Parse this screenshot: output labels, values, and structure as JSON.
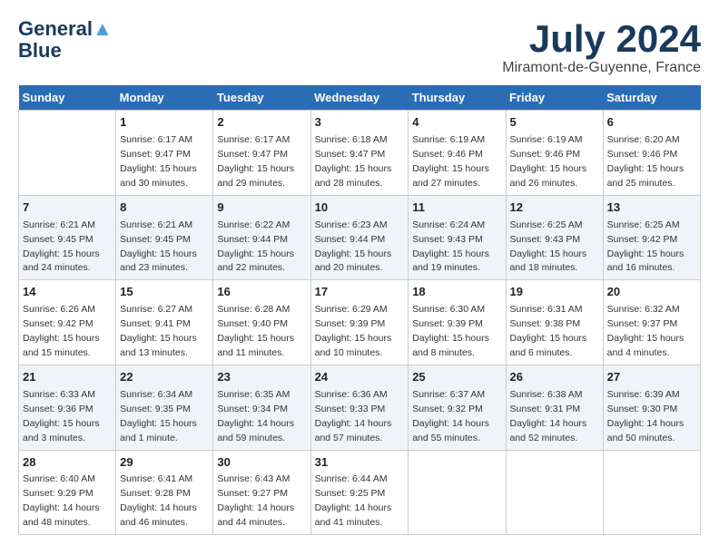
{
  "header": {
    "logo_line1": "General",
    "logo_line2": "Blue",
    "month_title": "July 2024",
    "location": "Miramont-de-Guyenne, France"
  },
  "days_of_week": [
    "Sunday",
    "Monday",
    "Tuesday",
    "Wednesday",
    "Thursday",
    "Friday",
    "Saturday"
  ],
  "weeks": [
    [
      {
        "day": "",
        "sunrise": "",
        "sunset": "",
        "daylight": ""
      },
      {
        "day": "1",
        "sunrise": "Sunrise: 6:17 AM",
        "sunset": "Sunset: 9:47 PM",
        "daylight": "Daylight: 15 hours and 30 minutes."
      },
      {
        "day": "2",
        "sunrise": "Sunrise: 6:17 AM",
        "sunset": "Sunset: 9:47 PM",
        "daylight": "Daylight: 15 hours and 29 minutes."
      },
      {
        "day": "3",
        "sunrise": "Sunrise: 6:18 AM",
        "sunset": "Sunset: 9:47 PM",
        "daylight": "Daylight: 15 hours and 28 minutes."
      },
      {
        "day": "4",
        "sunrise": "Sunrise: 6:19 AM",
        "sunset": "Sunset: 9:46 PM",
        "daylight": "Daylight: 15 hours and 27 minutes."
      },
      {
        "day": "5",
        "sunrise": "Sunrise: 6:19 AM",
        "sunset": "Sunset: 9:46 PM",
        "daylight": "Daylight: 15 hours and 26 minutes."
      },
      {
        "day": "6",
        "sunrise": "Sunrise: 6:20 AM",
        "sunset": "Sunset: 9:46 PM",
        "daylight": "Daylight: 15 hours and 25 minutes."
      }
    ],
    [
      {
        "day": "7",
        "sunrise": "Sunrise: 6:21 AM",
        "sunset": "Sunset: 9:45 PM",
        "daylight": "Daylight: 15 hours and 24 minutes."
      },
      {
        "day": "8",
        "sunrise": "Sunrise: 6:21 AM",
        "sunset": "Sunset: 9:45 PM",
        "daylight": "Daylight: 15 hours and 23 minutes."
      },
      {
        "day": "9",
        "sunrise": "Sunrise: 6:22 AM",
        "sunset": "Sunset: 9:44 PM",
        "daylight": "Daylight: 15 hours and 22 minutes."
      },
      {
        "day": "10",
        "sunrise": "Sunrise: 6:23 AM",
        "sunset": "Sunset: 9:44 PM",
        "daylight": "Daylight: 15 hours and 20 minutes."
      },
      {
        "day": "11",
        "sunrise": "Sunrise: 6:24 AM",
        "sunset": "Sunset: 9:43 PM",
        "daylight": "Daylight: 15 hours and 19 minutes."
      },
      {
        "day": "12",
        "sunrise": "Sunrise: 6:25 AM",
        "sunset": "Sunset: 9:43 PM",
        "daylight": "Daylight: 15 hours and 18 minutes."
      },
      {
        "day": "13",
        "sunrise": "Sunrise: 6:25 AM",
        "sunset": "Sunset: 9:42 PM",
        "daylight": "Daylight: 15 hours and 16 minutes."
      }
    ],
    [
      {
        "day": "14",
        "sunrise": "Sunrise: 6:26 AM",
        "sunset": "Sunset: 9:42 PM",
        "daylight": "Daylight: 15 hours and 15 minutes."
      },
      {
        "day": "15",
        "sunrise": "Sunrise: 6:27 AM",
        "sunset": "Sunset: 9:41 PM",
        "daylight": "Daylight: 15 hours and 13 minutes."
      },
      {
        "day": "16",
        "sunrise": "Sunrise: 6:28 AM",
        "sunset": "Sunset: 9:40 PM",
        "daylight": "Daylight: 15 hours and 11 minutes."
      },
      {
        "day": "17",
        "sunrise": "Sunrise: 6:29 AM",
        "sunset": "Sunset: 9:39 PM",
        "daylight": "Daylight: 15 hours and 10 minutes."
      },
      {
        "day": "18",
        "sunrise": "Sunrise: 6:30 AM",
        "sunset": "Sunset: 9:39 PM",
        "daylight": "Daylight: 15 hours and 8 minutes."
      },
      {
        "day": "19",
        "sunrise": "Sunrise: 6:31 AM",
        "sunset": "Sunset: 9:38 PM",
        "daylight": "Daylight: 15 hours and 6 minutes."
      },
      {
        "day": "20",
        "sunrise": "Sunrise: 6:32 AM",
        "sunset": "Sunset: 9:37 PM",
        "daylight": "Daylight: 15 hours and 4 minutes."
      }
    ],
    [
      {
        "day": "21",
        "sunrise": "Sunrise: 6:33 AM",
        "sunset": "Sunset: 9:36 PM",
        "daylight": "Daylight: 15 hours and 3 minutes."
      },
      {
        "day": "22",
        "sunrise": "Sunrise: 6:34 AM",
        "sunset": "Sunset: 9:35 PM",
        "daylight": "Daylight: 15 hours and 1 minute."
      },
      {
        "day": "23",
        "sunrise": "Sunrise: 6:35 AM",
        "sunset": "Sunset: 9:34 PM",
        "daylight": "Daylight: 14 hours and 59 minutes."
      },
      {
        "day": "24",
        "sunrise": "Sunrise: 6:36 AM",
        "sunset": "Sunset: 9:33 PM",
        "daylight": "Daylight: 14 hours and 57 minutes."
      },
      {
        "day": "25",
        "sunrise": "Sunrise: 6:37 AM",
        "sunset": "Sunset: 9:32 PM",
        "daylight": "Daylight: 14 hours and 55 minutes."
      },
      {
        "day": "26",
        "sunrise": "Sunrise: 6:38 AM",
        "sunset": "Sunset: 9:31 PM",
        "daylight": "Daylight: 14 hours and 52 minutes."
      },
      {
        "day": "27",
        "sunrise": "Sunrise: 6:39 AM",
        "sunset": "Sunset: 9:30 PM",
        "daylight": "Daylight: 14 hours and 50 minutes."
      }
    ],
    [
      {
        "day": "28",
        "sunrise": "Sunrise: 6:40 AM",
        "sunset": "Sunset: 9:29 PM",
        "daylight": "Daylight: 14 hours and 48 minutes."
      },
      {
        "day": "29",
        "sunrise": "Sunrise: 6:41 AM",
        "sunset": "Sunset: 9:28 PM",
        "daylight": "Daylight: 14 hours and 46 minutes."
      },
      {
        "day": "30",
        "sunrise": "Sunrise: 6:43 AM",
        "sunset": "Sunset: 9:27 PM",
        "daylight": "Daylight: 14 hours and 44 minutes."
      },
      {
        "day": "31",
        "sunrise": "Sunrise: 6:44 AM",
        "sunset": "Sunset: 9:25 PM",
        "daylight": "Daylight: 14 hours and 41 minutes."
      },
      {
        "day": "",
        "sunrise": "",
        "sunset": "",
        "daylight": ""
      },
      {
        "day": "",
        "sunrise": "",
        "sunset": "",
        "daylight": ""
      },
      {
        "day": "",
        "sunrise": "",
        "sunset": "",
        "daylight": ""
      }
    ]
  ]
}
